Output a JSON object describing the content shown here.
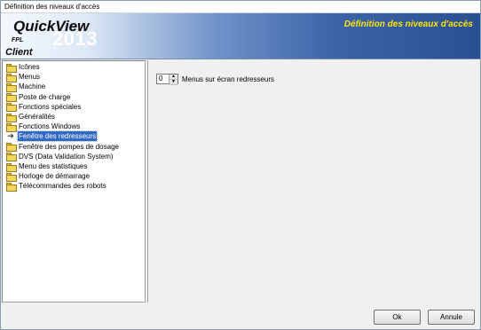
{
  "window": {
    "title": "Définition des niveaux d'accès"
  },
  "banner": {
    "app_name": "QuickView",
    "company": "FPL",
    "year": "2013",
    "role": "Client",
    "heading": "Définition des niveaux d'accès"
  },
  "tree": {
    "items": [
      {
        "label": "Icônes",
        "icon": "folder-icon"
      },
      {
        "label": "Menus",
        "icon": "folder-icon"
      },
      {
        "label": "Machine",
        "icon": "folder-icon"
      },
      {
        "label": "Poste de charge",
        "icon": "folder-icon"
      },
      {
        "label": "Fonctions spéciales",
        "icon": "folder-icon"
      },
      {
        "label": "Généralités",
        "icon": "folder-icon"
      },
      {
        "label": "Fonctions Windows",
        "icon": "folder-icon"
      },
      {
        "label": "Fenêtre des redresseurs",
        "icon": "arrow-icon",
        "selected": true
      },
      {
        "label": "Fenêtre des pompes de dosage",
        "icon": "folder-icon"
      },
      {
        "label": "DVS (Data Validation System)",
        "icon": "folder-icon"
      },
      {
        "label": "Menu des statistiques",
        "icon": "folder-icon"
      },
      {
        "label": "Horloge de démarrage",
        "icon": "folder-icon"
      },
      {
        "label": "Télécommandes des robots",
        "icon": "folder-icon"
      }
    ]
  },
  "content": {
    "setting": {
      "value": "0",
      "label": "Menus sur écran redresseurs"
    }
  },
  "footer": {
    "ok_label": "Ok",
    "cancel_label": "Annule"
  }
}
